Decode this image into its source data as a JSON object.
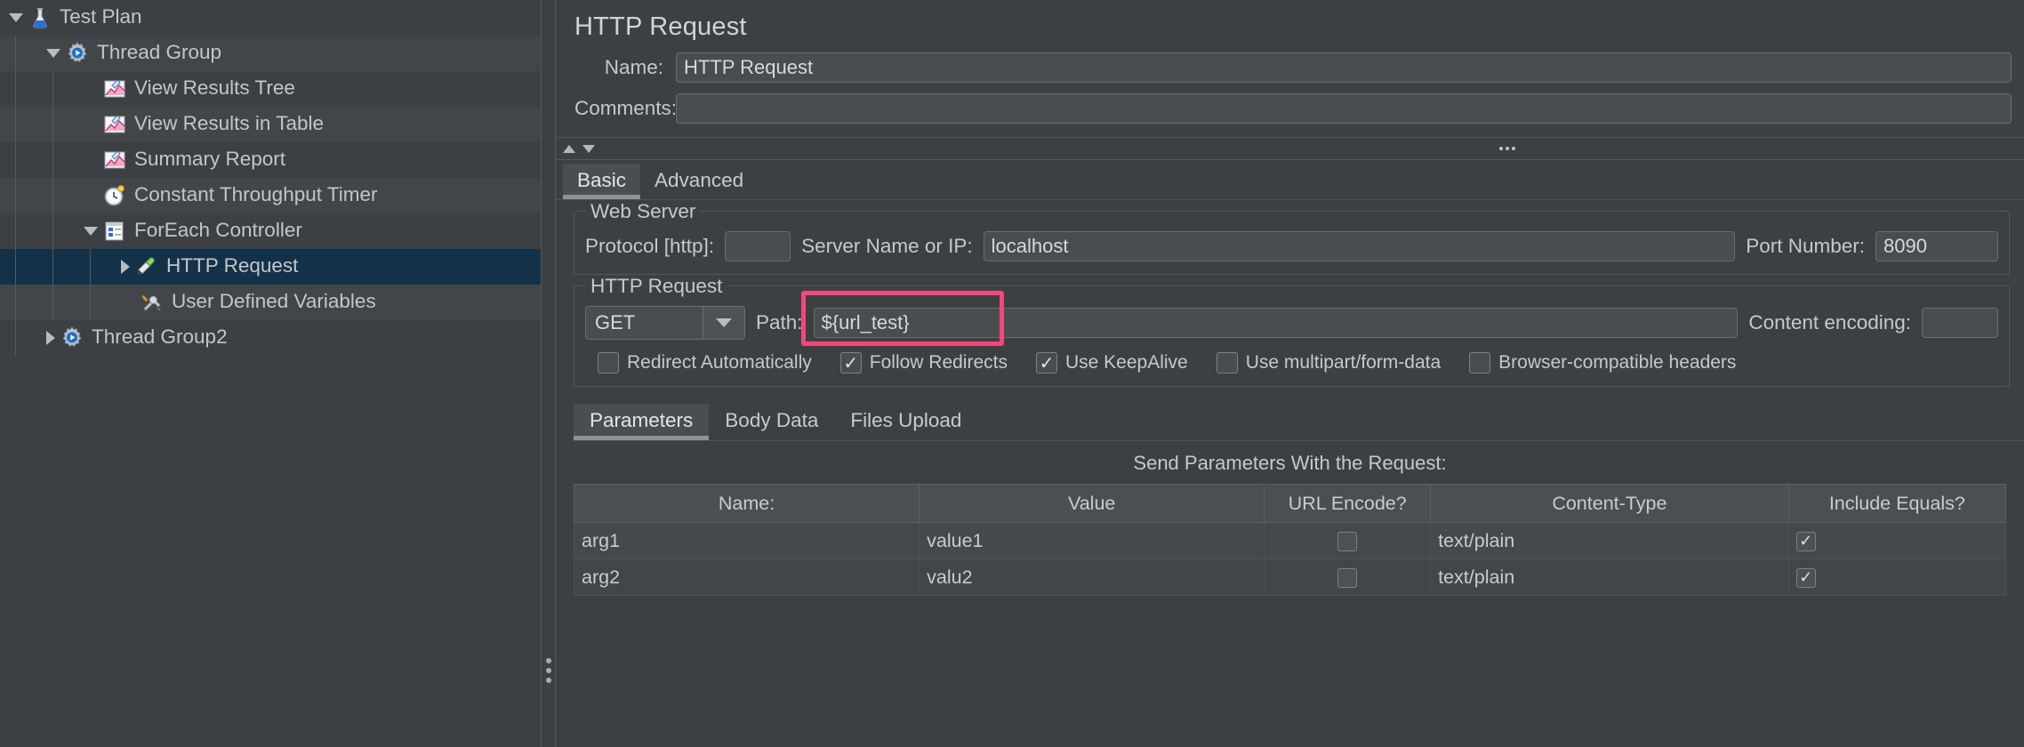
{
  "tree": {
    "items": [
      {
        "label": "Test Plan",
        "icon": "flask-icon",
        "depth": 0,
        "twisty": "down",
        "selected": false,
        "alt": false
      },
      {
        "label": "Thread Group",
        "icon": "gear-play-icon",
        "depth": 1,
        "twisty": "down",
        "selected": false,
        "alt": true
      },
      {
        "label": "View Results Tree",
        "icon": "chart-icon",
        "depth": 2,
        "twisty": "none",
        "selected": false,
        "alt": false
      },
      {
        "label": "View Results in Table",
        "icon": "chart-icon",
        "depth": 2,
        "twisty": "none",
        "selected": false,
        "alt": true
      },
      {
        "label": "Summary Report",
        "icon": "chart-icon",
        "depth": 2,
        "twisty": "none",
        "selected": false,
        "alt": false
      },
      {
        "label": "Constant Throughput Timer",
        "icon": "clock-icon",
        "depth": 2,
        "twisty": "none",
        "selected": false,
        "alt": true
      },
      {
        "label": "ForEach Controller",
        "icon": "controller-icon",
        "depth": 2,
        "twisty": "down",
        "selected": false,
        "alt": false
      },
      {
        "label": "HTTP Request",
        "icon": "pipette-icon",
        "depth": 3,
        "twisty": "right",
        "selected": true,
        "alt": false
      },
      {
        "label": "User Defined Variables",
        "icon": "tools-icon",
        "depth": 3,
        "twisty": "none",
        "selected": false,
        "alt": true
      },
      {
        "label": "Thread Group2",
        "icon": "gear-play-icon",
        "depth": 1,
        "twisty": "right",
        "selected": false,
        "alt": false
      }
    ]
  },
  "panel": {
    "title": "HTTP Request",
    "name_label": "Name:",
    "name_value": "HTTP Request",
    "comments_label": "Comments:",
    "comments_value": ""
  },
  "main_tabs": [
    {
      "label": "Basic",
      "active": true
    },
    {
      "label": "Advanced",
      "active": false
    }
  ],
  "web_server": {
    "group_title": "Web Server",
    "protocol_label": "Protocol [http]:",
    "protocol_value": "",
    "server_label": "Server Name or IP:",
    "server_value": "localhost",
    "port_label": "Port Number:",
    "port_value": "8090"
  },
  "http_request": {
    "group_title": "HTTP Request",
    "method_value": "GET",
    "path_label": "Path:",
    "path_value": "${url_test}",
    "encoding_label": "Content encoding:",
    "encoding_value": "",
    "highlight_color": "#f6457f"
  },
  "options": [
    {
      "label": "Redirect Automatically",
      "checked": false
    },
    {
      "label": "Follow Redirects",
      "checked": true
    },
    {
      "label": "Use KeepAlive",
      "checked": true
    },
    {
      "label": "Use multipart/form-data",
      "checked": false
    },
    {
      "label": "Browser-compatible headers",
      "checked": false
    }
  ],
  "sub_tabs": [
    {
      "label": "Parameters",
      "active": true
    },
    {
      "label": "Body Data",
      "active": false
    },
    {
      "label": "Files Upload",
      "active": false
    }
  ],
  "params_table": {
    "caption": "Send Parameters With the Request:",
    "headers": [
      "Name:",
      "Value",
      "URL Encode?",
      "Content-Type",
      "Include Equals?"
    ],
    "rows": [
      {
        "name": "arg1",
        "value": "value1",
        "url_encode": false,
        "content_type": "text/plain",
        "include_equals": true
      },
      {
        "name": "arg2",
        "value": "valu2",
        "url_encode": false,
        "content_type": "text/plain",
        "include_equals": true
      }
    ]
  }
}
